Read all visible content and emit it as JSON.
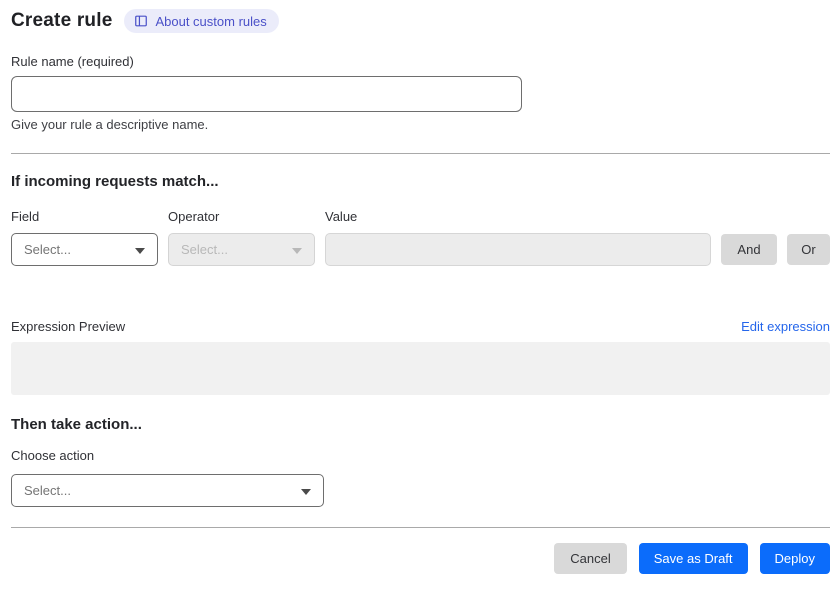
{
  "page": {
    "title": "Create rule",
    "badge": {
      "label": "About custom rules",
      "icon": "book-icon"
    }
  },
  "rule_name": {
    "label": "Rule name (required)",
    "value": "",
    "helper": "Give your rule a descriptive name."
  },
  "match_section": {
    "heading": "If incoming requests match...",
    "field": {
      "label": "Field",
      "selected": "Select..."
    },
    "operator": {
      "label": "Operator",
      "selected": "Select...",
      "disabled": true
    },
    "value": {
      "label": "Value",
      "value": "",
      "disabled": true
    },
    "and_button": "And",
    "or_button": "Or"
  },
  "expression": {
    "label": "Expression Preview",
    "edit_link": "Edit expression",
    "preview": ""
  },
  "action_section": {
    "heading": "Then take action...",
    "choose_label": "Choose action",
    "selected": "Select..."
  },
  "footer": {
    "cancel": "Cancel",
    "save_draft": "Save as Draft",
    "deploy": "Deploy"
  },
  "colors": {
    "accent_blue": "#0b6cfb",
    "link_blue": "#2566eb",
    "badge_bg": "#ebecfa",
    "badge_text": "#4a50c8",
    "neutral_button": "#d9d9d9",
    "disabled_bg": "#ececec",
    "preview_bg": "#f1f1f1",
    "divider": "#a9a9a9"
  }
}
